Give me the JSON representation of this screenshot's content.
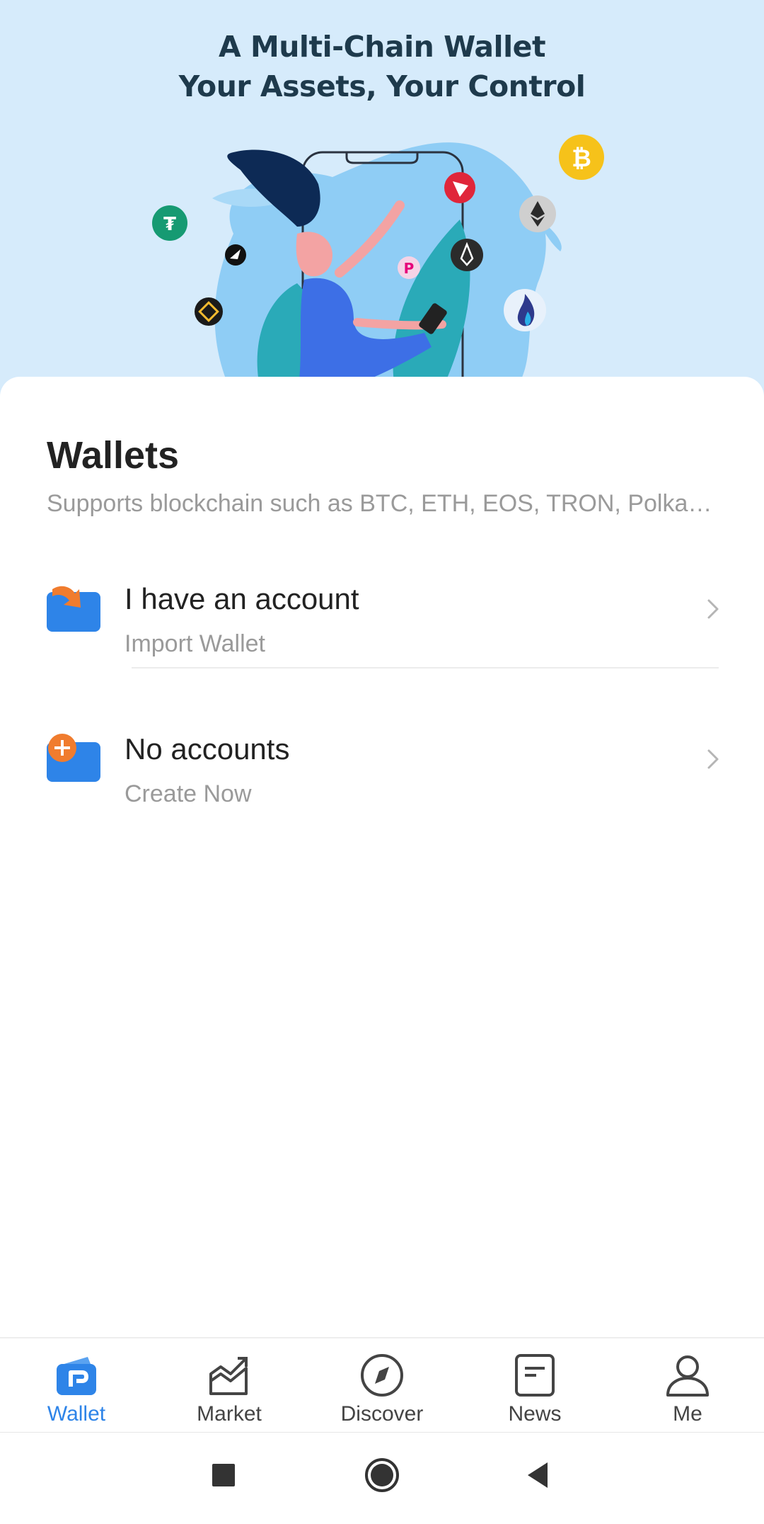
{
  "hero": {
    "title_line1": "A Multi-Chain Wallet",
    "title_line2": "Your Assets, Your Control"
  },
  "wallets": {
    "title": "Wallets",
    "subtitle": "Supports blockchain such as BTC, ETH, EOS, TRON, Polkadot",
    "options": [
      {
        "title": "I have an account",
        "subtitle": "Import Wallet",
        "icon": "import-wallet-icon"
      },
      {
        "title": "No accounts",
        "subtitle": "Create Now",
        "icon": "create-wallet-icon"
      }
    ]
  },
  "bottom_nav": {
    "items": [
      {
        "label": "Wallet",
        "icon": "wallet-icon",
        "active": true
      },
      {
        "label": "Market",
        "icon": "market-chart-icon",
        "active": false
      },
      {
        "label": "Discover",
        "icon": "compass-icon",
        "active": false
      },
      {
        "label": "News",
        "icon": "news-icon",
        "active": false
      },
      {
        "label": "Me",
        "icon": "person-icon",
        "active": false
      }
    ]
  },
  "system_nav": [
    "recents-button",
    "home-button",
    "back-button"
  ],
  "colors": {
    "accent": "#2e84e8",
    "hero_bg": "#d6ebfb",
    "orange": "#f07c2e",
    "text_primary": "#222222",
    "text_secondary": "#9a9a9a"
  }
}
